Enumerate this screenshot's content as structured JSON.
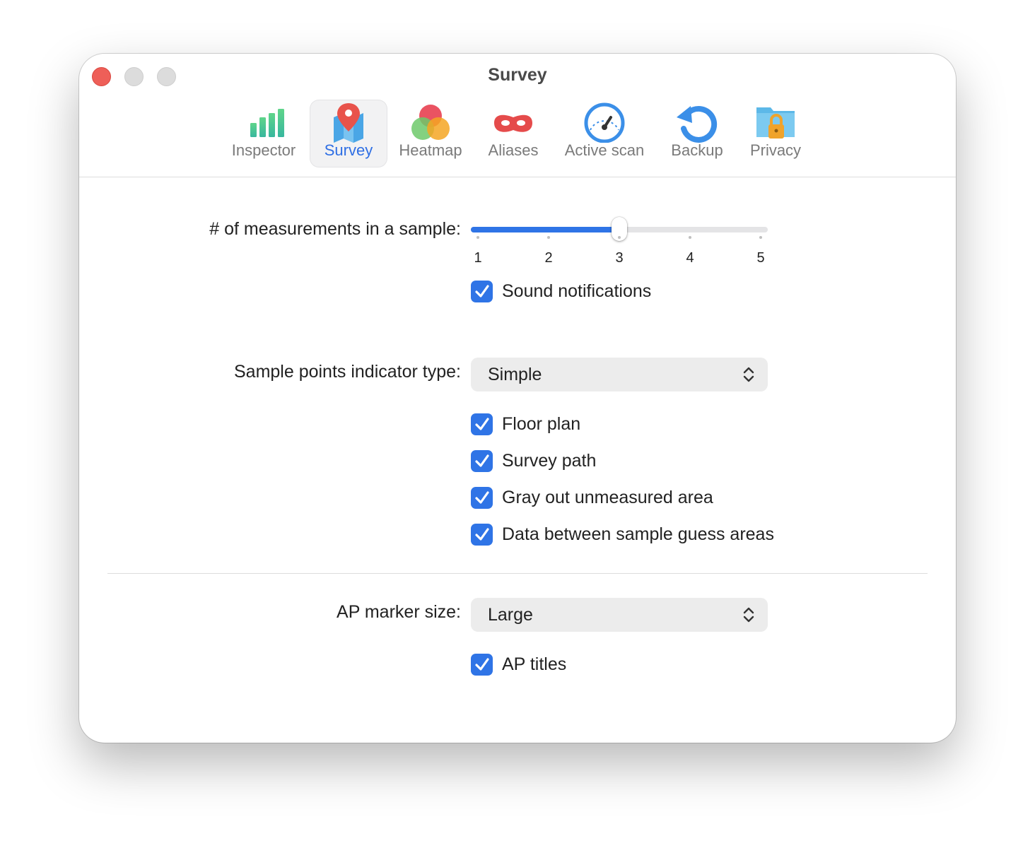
{
  "window": {
    "title": "Survey"
  },
  "toolbar": {
    "items": [
      {
        "label": "Inspector",
        "icon": "bar-chart-icon",
        "active": false
      },
      {
        "label": "Survey",
        "icon": "map-pin-icon",
        "active": true
      },
      {
        "label": "Heatmap",
        "icon": "heatmap-blob-icon",
        "active": false
      },
      {
        "label": "Aliases",
        "icon": "mask-icon",
        "active": false
      },
      {
        "label": "Active scan",
        "icon": "speedometer-icon",
        "active": false
      },
      {
        "label": "Backup",
        "icon": "backup-arrow-icon",
        "active": false
      },
      {
        "label": "Privacy",
        "icon": "lock-folder-icon",
        "active": false
      }
    ]
  },
  "measurements": {
    "label": "# of measurements in a sample:",
    "value": 3,
    "min": 1,
    "max": 5,
    "ticks": [
      "1",
      "2",
      "3",
      "4",
      "5"
    ]
  },
  "sound_notifications": {
    "label": "Sound notifications",
    "checked": true
  },
  "indicator_type": {
    "label": "Sample points indicator type:",
    "value": "Simple"
  },
  "options": [
    {
      "label": "Floor plan",
      "checked": true
    },
    {
      "label": "Survey path",
      "checked": true
    },
    {
      "label": "Gray out unmeasured area",
      "checked": true
    },
    {
      "label": "Data between sample guess areas",
      "checked": true
    }
  ],
  "ap_marker": {
    "label": "AP marker size:",
    "value": "Large"
  },
  "ap_titles": {
    "label": "AP titles",
    "checked": true
  },
  "colors": {
    "accent": "#2f74e6",
    "close": "#ee5f58"
  }
}
